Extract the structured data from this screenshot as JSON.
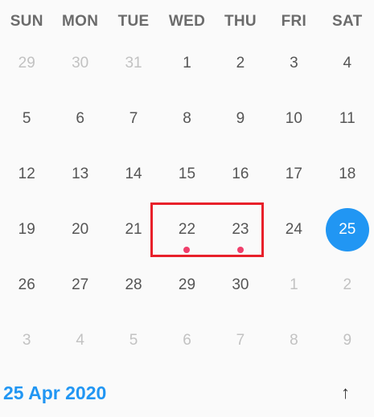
{
  "weekdays": [
    "SUN",
    "MON",
    "TUE",
    "WED",
    "THU",
    "FRI",
    "SAT"
  ],
  "weeks": [
    [
      {
        "day": "29",
        "muted": true
      },
      {
        "day": "30",
        "muted": true
      },
      {
        "day": "31",
        "muted": true
      },
      {
        "day": "1"
      },
      {
        "day": "2"
      },
      {
        "day": "3"
      },
      {
        "day": "4"
      }
    ],
    [
      {
        "day": "5"
      },
      {
        "day": "6"
      },
      {
        "day": "7"
      },
      {
        "day": "8"
      },
      {
        "day": "9"
      },
      {
        "day": "10"
      },
      {
        "day": "11"
      }
    ],
    [
      {
        "day": "12"
      },
      {
        "day": "13"
      },
      {
        "day": "14"
      },
      {
        "day": "15"
      },
      {
        "day": "16"
      },
      {
        "day": "17"
      },
      {
        "day": "18"
      }
    ],
    [
      {
        "day": "19"
      },
      {
        "day": "20"
      },
      {
        "day": "21"
      },
      {
        "day": "22",
        "event": true
      },
      {
        "day": "23",
        "event": true
      },
      {
        "day": "24"
      },
      {
        "day": "25",
        "selected": true
      }
    ],
    [
      {
        "day": "26"
      },
      {
        "day": "27"
      },
      {
        "day": "28"
      },
      {
        "day": "29"
      },
      {
        "day": "30"
      },
      {
        "day": "1",
        "muted": true
      },
      {
        "day": "2",
        "muted": true
      }
    ],
    [
      {
        "day": "3",
        "muted": true
      },
      {
        "day": "4",
        "muted": true
      },
      {
        "day": "5",
        "muted": true
      },
      {
        "day": "6",
        "muted": true
      },
      {
        "day": "7",
        "muted": true
      },
      {
        "day": "8",
        "muted": true
      },
      {
        "day": "9",
        "muted": true
      }
    ]
  ],
  "footer": {
    "selected_date": "25 Apr 2020",
    "up_arrow": "↑"
  },
  "colors": {
    "accent": "#2196f3",
    "event_dot": "#ef3f6b",
    "highlight_border": "#e8202a"
  }
}
